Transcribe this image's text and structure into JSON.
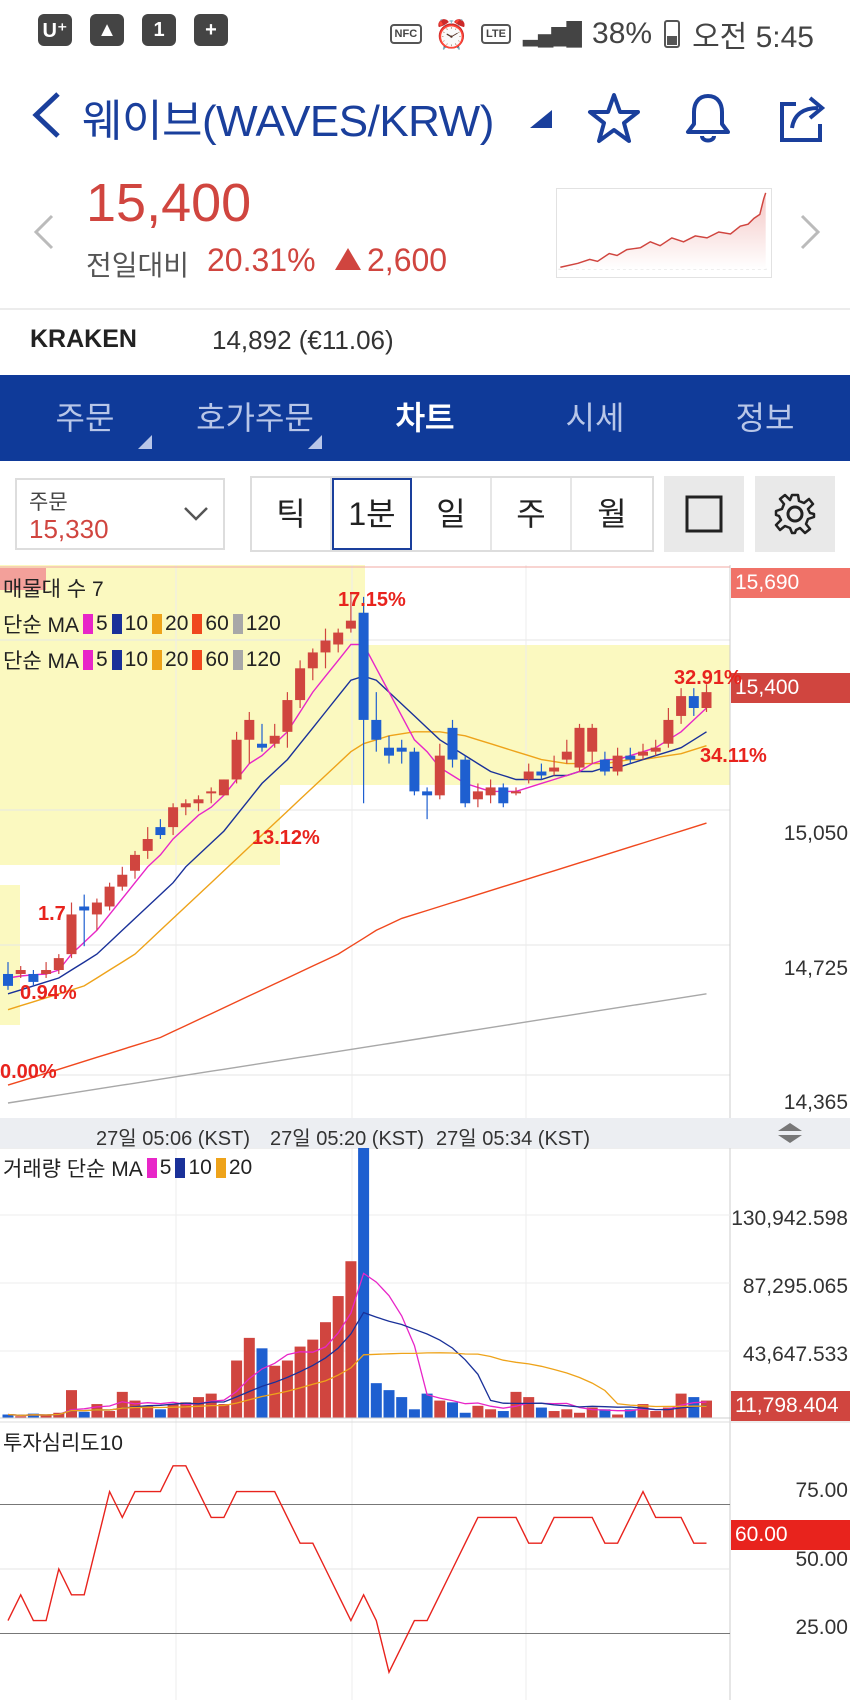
{
  "status_bar": {
    "left_icons": [
      "carrier-icon",
      "gallery-icon",
      "one-icon",
      "battery-saver-icon"
    ],
    "nfc": "NFC",
    "lte": "LTE",
    "battery": "38%",
    "time": "오전 5:45"
  },
  "header": {
    "title": "웨이브(WAVES/KRW)"
  },
  "price": {
    "current": "15,400",
    "change_label": "전일대비",
    "change_pct": "20.31%",
    "change_amt": "2,600"
  },
  "exchange": {
    "name": "KRAKEN",
    "value": "14,892 (€11.06)"
  },
  "tabs": [
    {
      "label": "주문"
    },
    {
      "label": "호가주문"
    },
    {
      "label": "차트"
    },
    {
      "label": "시세"
    },
    {
      "label": "정보"
    }
  ],
  "order": {
    "label": "주문",
    "value": "15,330"
  },
  "periods": [
    "틱",
    "1분",
    "일",
    "주",
    "월"
  ],
  "colors": {
    "up": "#d0453f",
    "down": "#1e5fd0",
    "ma5": "#e826c8",
    "ma10": "#1a3199",
    "ma20": "#eea31a",
    "ma60": "#f0481e",
    "ma120": "#a8a8a8",
    "tabbar": "#0f3a99"
  },
  "chart": {
    "legend_top": "매물대 수 7",
    "ma_label": "단순 MA",
    "ma_periods": [
      "5",
      "10",
      "20",
      "60",
      "120"
    ],
    "price_axis": [
      "15,690",
      "15,400",
      "15,050",
      "14,725",
      "14,365"
    ],
    "current_tag": "15,400",
    "high_tag": "15,690",
    "pct_labels": [
      "17.15%",
      "32.91%",
      "34.11%",
      "13.12%",
      "1.7",
      "0.94%",
      "0.00%"
    ],
    "time_labels": [
      "27일 05:06 (KST)",
      "27일 05:20 (KST)",
      "27일 05:34 (KST)"
    ],
    "volume": {
      "legend": "거래량 단순 MA",
      "ma_periods": [
        "5",
        "10",
        "20"
      ],
      "axis": [
        "130,942.598",
        "87,295.065",
        "43,647.533"
      ],
      "current_tag": "11,798.404"
    },
    "sentiment": {
      "legend": "투자심리도10",
      "axis": [
        "75.00",
        "50.00",
        "25.00"
      ],
      "current_tag": "60.00"
    }
  },
  "chart_data": {
    "type": "candlestick",
    "ylim": [
      14365,
      15690
    ],
    "candles": [
      {
        "o": 14660,
        "c": 14690,
        "h": 14720,
        "l": 14650,
        "up": false
      },
      {
        "o": 14700,
        "c": 14690,
        "h": 14710,
        "l": 14680,
        "up": true
      },
      {
        "o": 14690,
        "c": 14670,
        "h": 14700,
        "l": 14660,
        "up": false
      },
      {
        "o": 14690,
        "c": 14700,
        "h": 14720,
        "l": 14680,
        "up": true
      },
      {
        "o": 14700,
        "c": 14730,
        "h": 14740,
        "l": 14690,
        "up": true
      },
      {
        "o": 14740,
        "c": 14840,
        "h": 14870,
        "l": 14730,
        "up": true
      },
      {
        "o": 14850,
        "c": 14860,
        "h": 14890,
        "l": 14760,
        "up": false
      },
      {
        "o": 14840,
        "c": 14870,
        "h": 14880,
        "l": 14800,
        "up": true
      },
      {
        "o": 14860,
        "c": 14910,
        "h": 14920,
        "l": 14850,
        "up": true
      },
      {
        "o": 14910,
        "c": 14940,
        "h": 14960,
        "l": 14900,
        "up": true
      },
      {
        "o": 14950,
        "c": 14990,
        "h": 15000,
        "l": 14930,
        "up": true
      },
      {
        "o": 15000,
        "c": 15030,
        "h": 15060,
        "l": 14980,
        "up": true
      },
      {
        "o": 15060,
        "c": 15040,
        "h": 15080,
        "l": 15030,
        "up": false
      },
      {
        "o": 15060,
        "c": 15110,
        "h": 15120,
        "l": 15040,
        "up": true
      },
      {
        "o": 15110,
        "c": 15120,
        "h": 15130,
        "l": 15090,
        "up": true
      },
      {
        "o": 15120,
        "c": 15130,
        "h": 15140,
        "l": 15100,
        "up": true
      },
      {
        "o": 15150,
        "c": 15150,
        "h": 15160,
        "l": 15120,
        "up": true
      },
      {
        "o": 15140,
        "c": 15180,
        "h": 15180,
        "l": 15140,
        "up": true
      },
      {
        "o": 15180,
        "c": 15280,
        "h": 15300,
        "l": 15170,
        "up": true
      },
      {
        "o": 15280,
        "c": 15330,
        "h": 15350,
        "l": 15220,
        "up": true
      },
      {
        "o": 15270,
        "c": 15260,
        "h": 15320,
        "l": 15250,
        "up": false
      },
      {
        "o": 15270,
        "c": 15290,
        "h": 15320,
        "l": 15260,
        "up": true
      },
      {
        "o": 15300,
        "c": 15380,
        "h": 15400,
        "l": 15260,
        "up": true
      },
      {
        "o": 15380,
        "c": 15460,
        "h": 15480,
        "l": 15360,
        "up": true
      },
      {
        "o": 15460,
        "c": 15500,
        "h": 15510,
        "l": 15430,
        "up": true
      },
      {
        "o": 15500,
        "c": 15530,
        "h": 15560,
        "l": 15460,
        "up": true
      },
      {
        "o": 15520,
        "c": 15550,
        "h": 15560,
        "l": 15500,
        "up": true
      },
      {
        "o": 15560,
        "c": 15580,
        "h": 15650,
        "l": 15550,
        "up": true
      },
      {
        "o": 15600,
        "c": 15330,
        "h": 15640,
        "l": 15120,
        "up": false
      },
      {
        "o": 15330,
        "c": 15280,
        "h": 15400,
        "l": 15250,
        "up": false
      },
      {
        "o": 15260,
        "c": 15240,
        "h": 15290,
        "l": 15220,
        "up": false
      },
      {
        "o": 15260,
        "c": 15250,
        "h": 15280,
        "l": 15220,
        "up": false
      },
      {
        "o": 15250,
        "c": 15150,
        "h": 15260,
        "l": 15140,
        "up": false
      },
      {
        "o": 15150,
        "c": 15140,
        "h": 15160,
        "l": 15080,
        "up": false
      },
      {
        "o": 15140,
        "c": 15240,
        "h": 15270,
        "l": 15130,
        "up": true
      },
      {
        "o": 15310,
        "c": 15230,
        "h": 15330,
        "l": 15210,
        "up": false
      },
      {
        "o": 15230,
        "c": 15120,
        "h": 15240,
        "l": 15110,
        "up": false
      },
      {
        "o": 15130,
        "c": 15150,
        "h": 15170,
        "l": 15110,
        "up": true
      },
      {
        "o": 15140,
        "c": 15160,
        "h": 15180,
        "l": 15120,
        "up": true
      },
      {
        "o": 15160,
        "c": 15120,
        "h": 15170,
        "l": 15110,
        "up": false
      },
      {
        "o": 15150,
        "c": 15150,
        "h": 15160,
        "l": 15140,
        "up": true
      },
      {
        "o": 15180,
        "c": 15200,
        "h": 15220,
        "l": 15170,
        "up": true
      },
      {
        "o": 15200,
        "c": 15190,
        "h": 15220,
        "l": 15180,
        "up": false
      },
      {
        "o": 15200,
        "c": 15210,
        "h": 15240,
        "l": 15190,
        "up": true
      },
      {
        "o": 15250,
        "c": 15230,
        "h": 15280,
        "l": 15220,
        "up": true
      },
      {
        "o": 15210,
        "c": 15310,
        "h": 15320,
        "l": 15200,
        "up": true
      },
      {
        "o": 15250,
        "c": 15310,
        "h": 15320,
        "l": 15220,
        "up": true
      },
      {
        "o": 15230,
        "c": 15200,
        "h": 15250,
        "l": 15190,
        "up": false
      },
      {
        "o": 15200,
        "c": 15240,
        "h": 15260,
        "l": 15190,
        "up": true
      },
      {
        "o": 15240,
        "c": 15230,
        "h": 15260,
        "l": 15220,
        "up": false
      },
      {
        "o": 15240,
        "c": 15250,
        "h": 15270,
        "l": 15230,
        "up": true
      },
      {
        "o": 15250,
        "c": 15260,
        "h": 15280,
        "l": 15240,
        "up": true
      },
      {
        "o": 15270,
        "c": 15330,
        "h": 15360,
        "l": 15260,
        "up": true
      },
      {
        "o": 15340,
        "c": 15390,
        "h": 15410,
        "l": 15320,
        "up": true
      },
      {
        "o": 15390,
        "c": 15360,
        "h": 15410,
        "l": 15340,
        "up": false
      },
      {
        "o": 15360,
        "c": 15400,
        "h": 15420,
        "l": 15350,
        "up": true
      }
    ],
    "ma5": [
      14680,
      14685,
      14688,
      14690,
      14700,
      14740,
      14770,
      14800,
      14840,
      14880,
      14920,
      14960,
      14990,
      15030,
      15060,
      15090,
      15110,
      15140,
      15180,
      15220,
      15240,
      15270,
      15300,
      15350,
      15400,
      15440,
      15480,
      15520,
      15520,
      15460,
      15400,
      15340,
      15280,
      15250,
      15210,
      15190,
      15170,
      15160,
      15150,
      15150,
      15150,
      15160,
      15170,
      15180,
      15190,
      15200,
      15220,
      15230,
      15230,
      15240,
      15250,
      15260,
      15280,
      15300,
      15330,
      15360
    ],
    "ma10": [
      14640,
      14650,
      14660,
      14670,
      14680,
      14700,
      14720,
      14740,
      14770,
      14800,
      14830,
      14860,
      14890,
      14920,
      14960,
      14990,
      15020,
      15050,
      15090,
      15130,
      15170,
      15200,
      15230,
      15270,
      15310,
      15350,
      15390,
      15430,
      15440,
      15430,
      15400,
      15370,
      15340,
      15310,
      15280,
      15260,
      15240,
      15220,
      15200,
      15190,
      15180,
      15180,
      15180,
      15190,
      15190,
      15200,
      15200,
      15210,
      15210,
      15220,
      15230,
      15240,
      15250,
      15260,
      15280,
      15300
    ],
    "ma20": [
      14600,
      14610,
      14620,
      14630,
      14640,
      14650,
      14660,
      14680,
      14700,
      14720,
      14740,
      14770,
      14800,
      14830,
      14860,
      14890,
      14920,
      14950,
      14980,
      15010,
      15040,
      15070,
      15100,
      15130,
      15160,
      15190,
      15220,
      15250,
      15270,
      15280,
      15290,
      15295,
      15300,
      15300,
      15300,
      15295,
      15290,
      15280,
      15270,
      15260,
      15250,
      15240,
      15230,
      15225,
      15220,
      15220,
      15220,
      15220,
      15225,
      15230,
      15230,
      15235,
      15240,
      15245,
      15255,
      15265
    ],
    "ma60": [
      14410,
      14420,
      14430,
      14440,
      14450,
      14460,
      14470,
      14480,
      14490,
      14500,
      14510,
      14520,
      14530,
      14545,
      14560,
      14575,
      14590,
      14605,
      14620,
      14635,
      14650,
      14665,
      14680,
      14695,
      14710,
      14725,
      14740,
      14760,
      14780,
      14800,
      14815,
      14830,
      14840,
      14850,
      14860,
      14870,
      14880,
      14890,
      14900,
      14910,
      14920,
      14930,
      14940,
      14950,
      14960,
      14970,
      14980,
      14990,
      15000,
      15010,
      15020,
      15030,
      15040,
      15050,
      15060,
      15070
    ],
    "ma120": [
      14365,
      14370,
      14375,
      14380,
      14385,
      14390,
      14395,
      14400,
      14405,
      14410,
      14415,
      14420,
      14425,
      14430,
      14435,
      14440,
      14445,
      14450,
      14455,
      14460,
      14465,
      14470,
      14475,
      14480,
      14485,
      14490,
      14495,
      14500,
      14505,
      14510,
      14515,
      14520,
      14525,
      14530,
      14535,
      14540,
      14545,
      14550,
      14555,
      14560,
      14565,
      14570,
      14575,
      14580,
      14585,
      14590,
      14595,
      14600,
      14605,
      14610,
      14615,
      14620,
      14625,
      14630,
      14635,
      14640
    ],
    "volume": [
      2000,
      1000,
      2500,
      1500,
      3000,
      16000,
      3500,
      8000,
      4000,
      15000,
      10000,
      7000,
      5000,
      8000,
      9000,
      12000,
      14000,
      8000,
      33000,
      46000,
      40000,
      30000,
      33000,
      41000,
      45000,
      55000,
      70000,
      90000,
      155000,
      20000,
      16000,
      12000,
      5000,
      14000,
      10000,
      9000,
      3000,
      7000,
      5000,
      4000,
      15000,
      12000,
      6000,
      4000,
      5000,
      3000,
      6000,
      5000,
      2000,
      5000,
      8000,
      4000,
      6000,
      14000,
      12000,
      10000
    ],
    "volume_ylim": [
      0,
      155000
    ],
    "sentiment": [
      30,
      40,
      30,
      30,
      50,
      40,
      40,
      60,
      80,
      70,
      80,
      80,
      80,
      90,
      90,
      80,
      70,
      70,
      80,
      80,
      80,
      80,
      70,
      60,
      60,
      50,
      40,
      30,
      40,
      30,
      10,
      20,
      30,
      30,
      40,
      50,
      60,
      70,
      70,
      70,
      70,
      60,
      60,
      70,
      70,
      70,
      70,
      60,
      60,
      70,
      80,
      70,
      70,
      70,
      60,
      60
    ],
    "sentiment_ylim": [
      0,
      100
    ]
  }
}
